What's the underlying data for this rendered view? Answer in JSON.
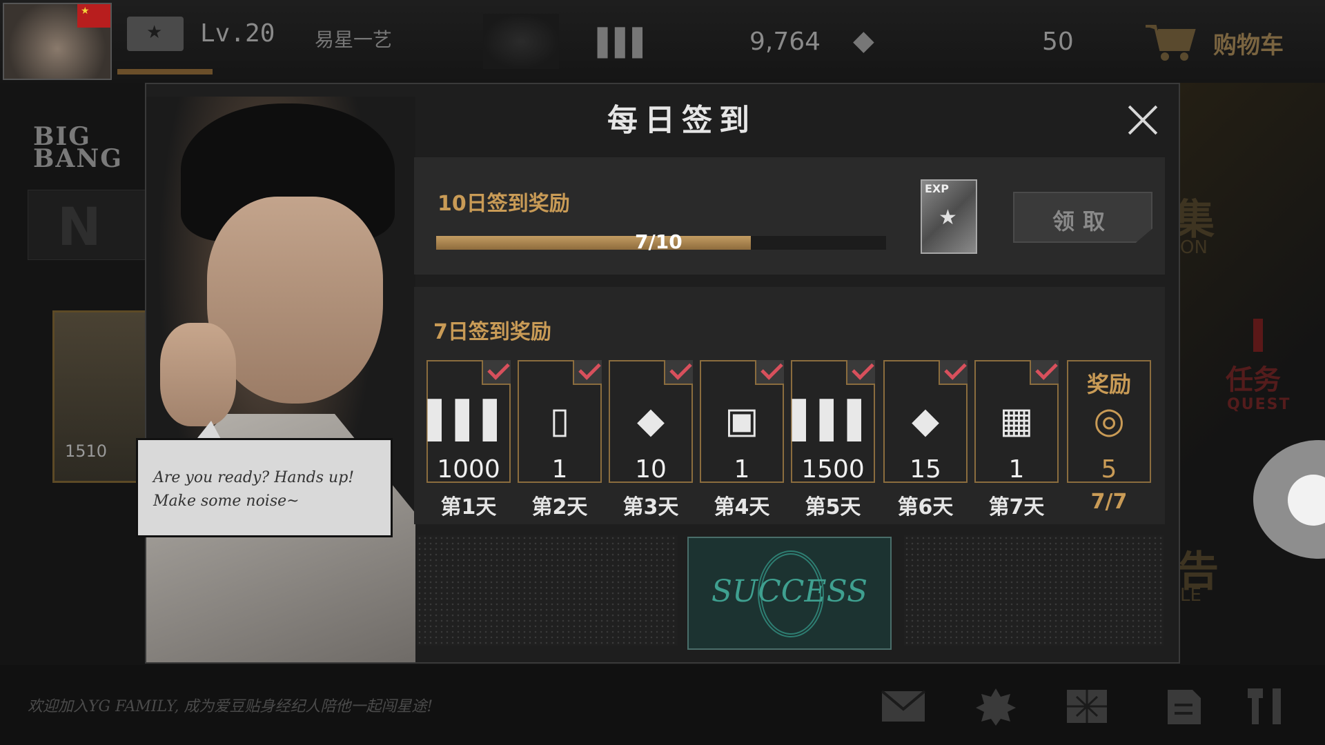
{
  "topbar": {
    "level": "Lv.20",
    "username": "易星一艺",
    "coins": "9,764",
    "gems": "50",
    "cart_label": "购物车"
  },
  "left": {
    "logo": "BIG BANG",
    "card_power": "1510"
  },
  "right": {
    "quest_cn": "任务",
    "quest_en": "QUEST"
  },
  "modal": {
    "title": "每日签到",
    "speech": [
      "Are you ready? Hands up!",
      "Make some noise~"
    ],
    "ten_day": {
      "title": "10日签到奖励",
      "progress_text": "7/10",
      "progress": 0.7,
      "reward_icon": "exp-card-icon",
      "claim_label": "领取"
    },
    "seven_day": {
      "title": "7日签到奖励",
      "days": [
        {
          "icon": "ticket-icon",
          "value": "1000",
          "label": "第1天",
          "checked": true
        },
        {
          "icon": "star-card-icon",
          "value": "1",
          "label": "第2天",
          "checked": true
        },
        {
          "icon": "diamond-icon",
          "value": "10",
          "label": "第3天",
          "checked": true
        },
        {
          "icon": "exp-card-icon",
          "value": "1",
          "label": "第4天",
          "checked": true
        },
        {
          "icon": "ticket-icon",
          "value": "1500",
          "label": "第5天",
          "checked": true
        },
        {
          "icon": "diamond-icon",
          "value": "15",
          "label": "第6天",
          "checked": true
        },
        {
          "icon": "four-star-card-icon",
          "value": "1",
          "label": "第7天",
          "checked": true
        }
      ],
      "reward": {
        "title": "奖励",
        "value": "5",
        "progress": "7/7"
      }
    },
    "success_text": "SUCCESS"
  },
  "bottombar": {
    "welcome": "欢迎加入YG FAMILY, 成为爱豆贴身经纪人陪他一起闯星途!"
  },
  "colors": {
    "gold": "#c99b56",
    "check": "#d8505c",
    "success": "#3fa090"
  }
}
